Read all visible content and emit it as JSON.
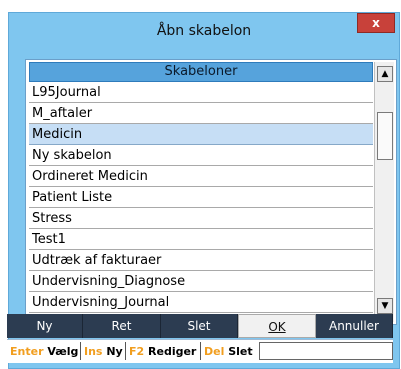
{
  "dialog": {
    "title": "Åbn skabelon",
    "close_label": "x"
  },
  "list": {
    "header": "Skabeloner",
    "items": [
      "L95Journal",
      "M_aftaler",
      "Medicin",
      "Ny skabelon",
      "Ordineret Medicin",
      "Patient Liste",
      "Stress",
      "Test1",
      "Udtræk af fakturaer",
      "Undervisning_Diagnose",
      "Undervisning_Journal"
    ],
    "selected_index": 2
  },
  "buttons": {
    "new": "Ny",
    "edit": "Ret",
    "delete": "Slet",
    "ok": "OK",
    "cancel": "Annuller"
  },
  "hotkeys": [
    {
      "key": "Enter",
      "label": "Vælg"
    },
    {
      "key": "Ins",
      "label": "Ny"
    },
    {
      "key": "F2",
      "label": "Rediger"
    },
    {
      "key": "Del",
      "label": "Slet"
    }
  ]
}
